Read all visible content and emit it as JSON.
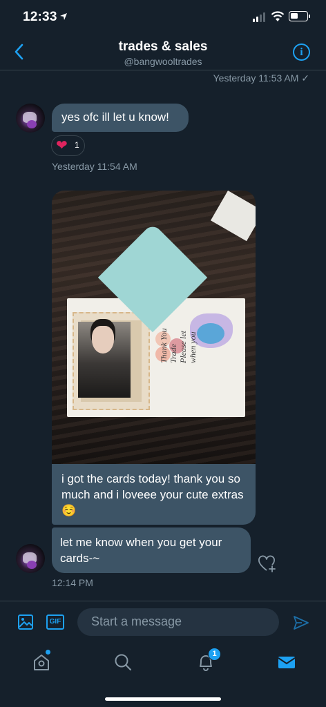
{
  "status": {
    "time": "12:33"
  },
  "header": {
    "title": "trades & sales",
    "handle": "@bangwooltrades"
  },
  "conversation": {
    "top_timestamp": "Yesterday 11:53 AM ✓",
    "received_1": {
      "text": "yes ofc ill let u know!",
      "reaction_emoji": "❤",
      "reaction_count": "1",
      "timestamp": "Yesterday 11:54 AM"
    },
    "photo_note": "Thank You\nTrade\nPlease let\nwhen you",
    "sent_caption": "i got the cards today! thank you so much and i loveee your cute extras ☺️",
    "received_2": {
      "text": "let me know when you get your cards-~",
      "timestamp": "12:14 PM"
    }
  },
  "composer": {
    "gif_label": "GIF",
    "placeholder": "Start a message"
  },
  "tabbar": {
    "notifications_badge": "1"
  },
  "colors": {
    "accent": "#1da1f2",
    "background": "#15202b",
    "bubble": "#3d5466",
    "muted": "#8899a6"
  }
}
